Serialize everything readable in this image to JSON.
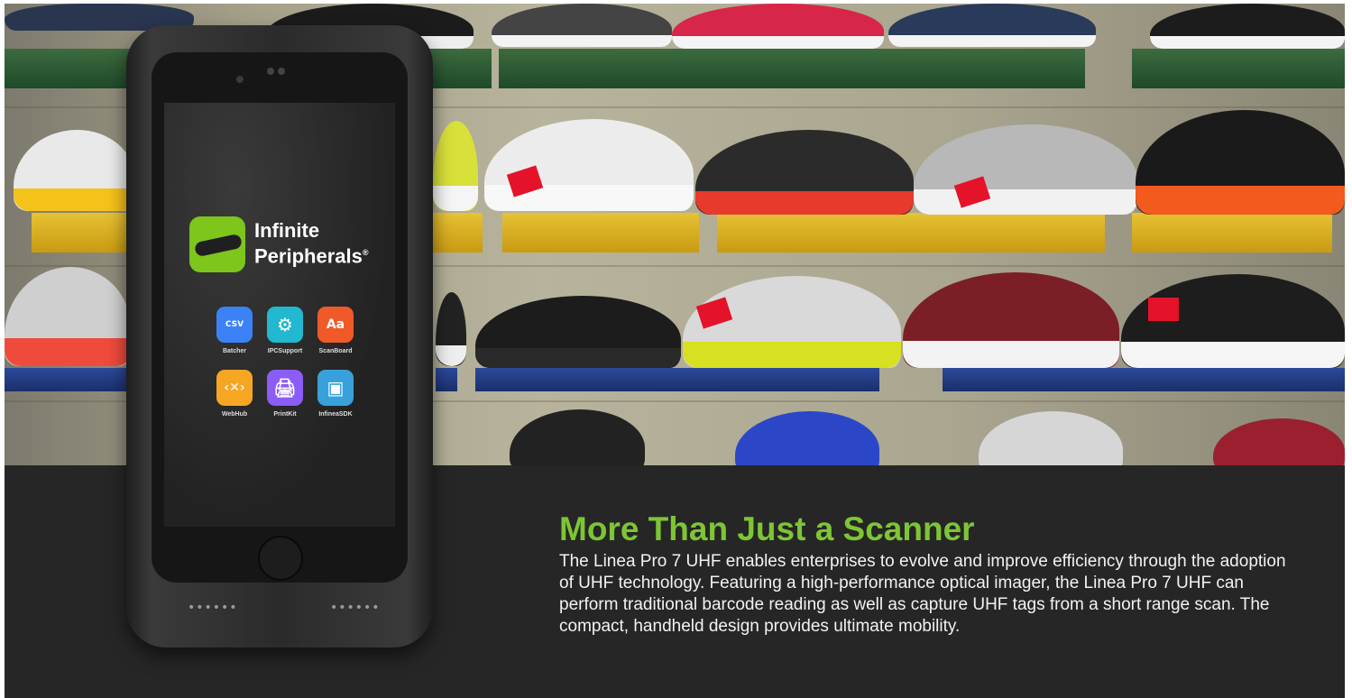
{
  "brand": {
    "line1": "Infinite",
    "line2": "Peripherals",
    "mark": "®"
  },
  "apps": [
    {
      "label": "Batcher",
      "icon": "csv-file-icon",
      "glyph": "CSV",
      "color": "#3b82f6"
    },
    {
      "label": "IPCSupport",
      "icon": "gears-icon",
      "glyph": "⚙",
      "color": "#22b8cf"
    },
    {
      "label": "ScanBoard",
      "icon": "barcode-keyboard-icon",
      "glyph": "Aa",
      "color": "#f05a28"
    },
    {
      "label": "WebHub",
      "icon": "code-tools-icon",
      "glyph": "‹✕›",
      "color": "#f6a623"
    },
    {
      "label": "PrintKit",
      "icon": "printer-icon",
      "glyph": "🖨",
      "color": "#8b5cf6"
    },
    {
      "label": "InfineaSDK",
      "icon": "toolbox-icon",
      "glyph": "▣",
      "color": "#38a1db"
    }
  ],
  "phone": {
    "grille_left": "••••••",
    "grille_right": "••••••"
  },
  "section": {
    "heading": "More Than Just a Scanner",
    "body": "The Linea Pro 7 UHF enables enterprises to evolve and improve efficiency through the adoption of UHF technology. Featuring a high-performance optical imager, the Linea Pro 7 UHF can perform traditional barcode reading as well as capture UHF tags from a short range scan. The compact, handheld design provides ultimate mobility."
  },
  "colors": {
    "accent": "#7ec535",
    "background": "#262626",
    "text": "#f2f2f2"
  }
}
